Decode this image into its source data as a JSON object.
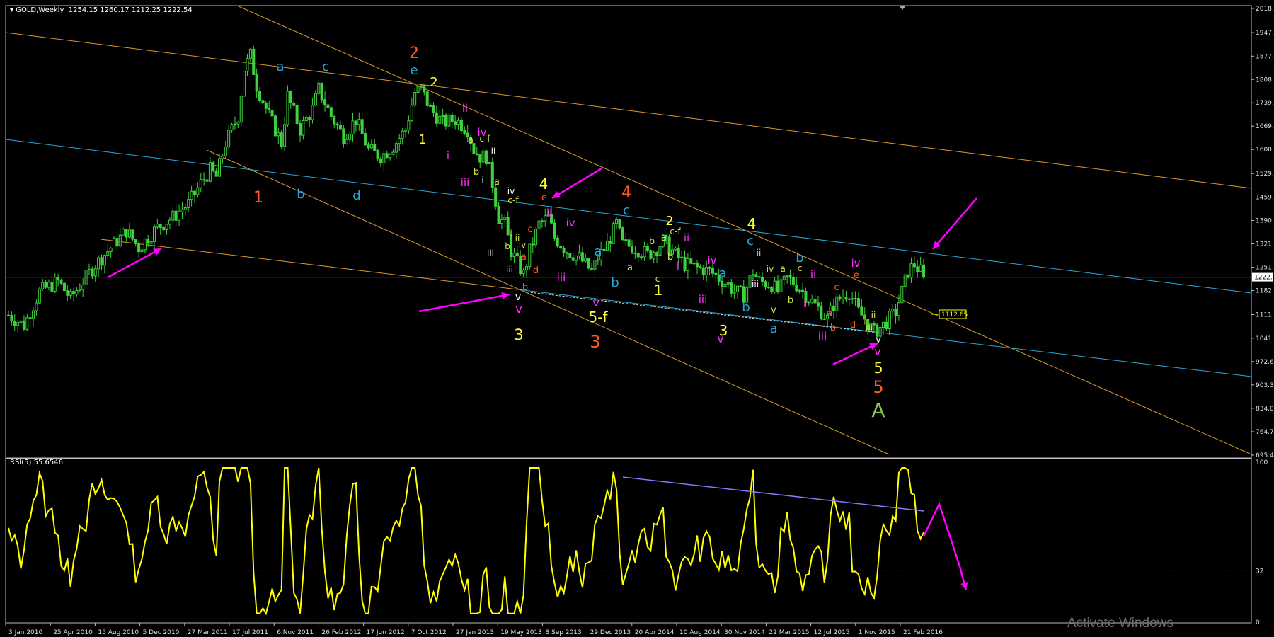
{
  "header": {
    "symbol": "GOLD,Weekly",
    "ohlc": "1254.15 1260.17 1212.25 1222.54"
  },
  "rsi_header": "RSI(5) 55.6546",
  "watermark": "Activate Windows",
  "price_marker": "1112.65",
  "current_price_label": "1222.5",
  "colors": {
    "candle": "#3cd33c",
    "orange_line": "#d99a2a",
    "blue_line": "#2aa7d6",
    "white_line": "#cfe6ef",
    "rsi": "#ffff00",
    "rsi_level": "#b0196e",
    "arrow": "#ff00ff",
    "rsi_trend": "#8877ff"
  },
  "chart_data": [
    {
      "type": "candlestick",
      "title": "GOLD,Weekly",
      "ylim": [
        695.4,
        2018.4
      ],
      "y_ticks": [
        "2018.4",
        "1947.0",
        "1877.3",
        "1808.2",
        "1739.1",
        "1669.9",
        "1600.8",
        "1529.5",
        "1459.5",
        "1390.5",
        "1321.3",
        "1251.9",
        "1182.8",
        "1111.6",
        "1041.6",
        "972.6",
        "903.3",
        "834.0",
        "764.7",
        "695.4"
      ],
      "x_ticks": [
        "3 Jan 2010",
        "25 Apr 2010",
        "15 Aug 2010",
        "5 Dec 2010",
        "27 Mar 2011",
        "17 Jul 2011",
        "6 Nov 2011",
        "26 Feb 2012",
        "17 Jun 2012",
        "7 Oct 2012",
        "27 Jan 2013",
        "19 May 2013",
        "8 Sep 2013",
        "29 Dec 2013",
        "20 Apr 2014",
        "10 Aug 2014",
        "30 Nov 2014",
        "22 Mar 2015",
        "12 Jul 2015",
        "1 Nov 2015",
        "21 Feb 2016"
      ],
      "close_path": [
        [
          0,
          1110
        ],
        [
          5,
          1080
        ],
        [
          10,
          1180
        ],
        [
          16,
          1210
        ],
        [
          20,
          1160
        ],
        [
          28,
          1260
        ],
        [
          33,
          1310
        ],
        [
          38,
          1360
        ],
        [
          42,
          1310
        ],
        [
          48,
          1370
        ],
        [
          53,
          1400
        ],
        [
          58,
          1440
        ],
        [
          62,
          1500
        ],
        [
          65,
          1540
        ],
        [
          67,
          1520
        ],
        [
          70,
          1620
        ],
        [
          74,
          1700
        ],
        [
          76,
          1840
        ],
        [
          78,
          1880
        ],
        [
          80,
          1790
        ],
        [
          84,
          1700
        ],
        [
          88,
          1620
        ],
        [
          90,
          1760
        ],
        [
          94,
          1660
        ],
        [
          98,
          1720
        ],
        [
          100,
          1780
        ],
        [
          104,
          1700
        ],
        [
          108,
          1640
        ],
        [
          112,
          1690
        ],
        [
          116,
          1600
        ],
        [
          120,
          1580
        ],
        [
          124,
          1610
        ],
        [
          128,
          1660
        ],
        [
          131,
          1770
        ],
        [
          133,
          1780
        ],
        [
          136,
          1720
        ],
        [
          140,
          1680
        ],
        [
          144,
          1690
        ],
        [
          148,
          1660
        ],
        [
          150,
          1600
        ],
        [
          152,
          1580
        ],
        [
          154,
          1580
        ],
        [
          156,
          1500
        ],
        [
          158,
          1400
        ],
        [
          160,
          1380
        ],
        [
          162,
          1300
        ],
        [
          166,
          1230
        ],
        [
          168,
          1300
        ],
        [
          171,
          1380
        ],
        [
          174,
          1400
        ],
        [
          176,
          1340
        ],
        [
          180,
          1300
        ],
        [
          184,
          1280
        ],
        [
          186,
          1260
        ],
        [
          188,
          1240
        ],
        [
          190,
          1280
        ],
        [
          193,
          1320
        ],
        [
          196,
          1380
        ],
        [
          198,
          1320
        ],
        [
          202,
          1310
        ],
        [
          206,
          1290
        ],
        [
          208,
          1300
        ],
        [
          211,
          1330
        ],
        [
          214,
          1300
        ],
        [
          218,
          1260
        ],
        [
          222,
          1250
        ],
        [
          226,
          1240
        ],
        [
          229,
          1220
        ],
        [
          232,
          1200
        ],
        [
          234,
          1180
        ],
        [
          237,
          1170
        ],
        [
          240,
          1240
        ],
        [
          242,
          1210
        ],
        [
          246,
          1200
        ],
        [
          248,
          1180
        ],
        [
          251,
          1220
        ],
        [
          254,
          1200
        ],
        [
          258,
          1160
        ],
        [
          261,
          1130
        ],
        [
          264,
          1100
        ],
        [
          266,
          1140
        ],
        [
          268,
          1160
        ],
        [
          271,
          1180
        ],
        [
          274,
          1120
        ],
        [
          276,
          1100
        ],
        [
          279,
          1060
        ],
        [
          282,
          1080
        ],
        [
          284,
          1100
        ],
        [
          286,
          1120
        ],
        [
          288,
          1180
        ],
        [
          290,
          1240
        ],
        [
          292,
          1260
        ],
        [
          294,
          1240
        ],
        [
          295,
          1222.54
        ]
      ]
    },
    {
      "type": "line",
      "title": "RSI(5) 55.6546",
      "ylim": [
        0,
        100
      ],
      "y_ticks": [
        "100",
        "32",
        "0"
      ],
      "levels": [
        32
      ]
    }
  ],
  "annotations": [
    {
      "t": "1",
      "c": "#ff5a1f",
      "x": 365,
      "y": 286,
      "s": 22
    },
    {
      "t": "2",
      "c": "#ff5a1f",
      "x": 585,
      "y": 82,
      "s": 22
    },
    {
      "t": "e",
      "c": "#2aa7d6",
      "x": 585,
      "y": 105,
      "s": 18
    },
    {
      "t": "2",
      "c": "#ffff33",
      "x": 613,
      "y": 122,
      "s": 18
    },
    {
      "t": "a",
      "c": "#2aa7d6",
      "x": 396,
      "y": 100,
      "s": 18
    },
    {
      "t": "c",
      "c": "#2aa7d6",
      "x": 460,
      "y": 100,
      "s": 18
    },
    {
      "t": "b",
      "c": "#2aa7d6",
      "x": 425,
      "y": 280,
      "s": 18
    },
    {
      "t": "d",
      "c": "#2aa7d6",
      "x": 504,
      "y": 282,
      "s": 18
    },
    {
      "t": "1",
      "c": "#ffff33",
      "x": 597,
      "y": 203,
      "s": 18
    },
    {
      "t": "ii",
      "c": "#ff33ff",
      "x": 657,
      "y": 158,
      "s": 15
    },
    {
      "t": "iv",
      "c": "#ff33ff",
      "x": 681,
      "y": 192,
      "s": 15
    },
    {
      "t": "c-f",
      "c": "#d2e84a",
      "x": 685,
      "y": 200,
      "s": 12
    },
    {
      "t": "ii",
      "c": "#ffffff",
      "x": 697,
      "y": 218,
      "s": 12
    },
    {
      "t": "a",
      "c": "#d2e84a",
      "x": 665,
      "y": 202,
      "s": 13
    },
    {
      "t": "i",
      "c": "#ff33ff",
      "x": 633,
      "y": 225,
      "s": 15
    },
    {
      "t": "b",
      "c": "#d2e84a",
      "x": 673,
      "y": 247,
      "s": 13
    },
    {
      "t": "i",
      "c": "#ffffff",
      "x": 682,
      "y": 258,
      "s": 12
    },
    {
      "t": "iii",
      "c": "#ff33ff",
      "x": 657,
      "y": 263,
      "s": 15
    },
    {
      "t": "a",
      "c": "#d2e84a",
      "x": 702,
      "y": 261,
      "s": 13
    },
    {
      "t": "iv",
      "c": "#ffffff",
      "x": 722,
      "y": 274,
      "s": 12
    },
    {
      "t": "c-f",
      "c": "#d2e84a",
      "x": 725,
      "y": 287,
      "s": 12
    },
    {
      "t": "iii",
      "c": "#ffffff",
      "x": 693,
      "y": 362,
      "s": 12
    },
    {
      "t": "ii",
      "c": "#d2e84a",
      "x": 731,
      "y": 340,
      "s": 12
    },
    {
      "t": "i",
      "c": "#d2e84a",
      "x": 722,
      "y": 334,
      "s": 12
    },
    {
      "t": "b",
      "c": "#d2e84a",
      "x": 717,
      "y": 352,
      "s": 12
    },
    {
      "t": "iv",
      "c": "#d2e84a",
      "x": 738,
      "y": 350,
      "s": 12
    },
    {
      "t": "a",
      "c": "#ff5a1f",
      "x": 740,
      "y": 367,
      "s": 13
    },
    {
      "t": "iii",
      "c": "#d2e84a",
      "x": 720,
      "y": 385,
      "s": 12
    },
    {
      "t": "b",
      "c": "#ff5a1f",
      "x": 742,
      "y": 410,
      "s": 13
    },
    {
      "t": "c",
      "c": "#ff5a1f",
      "x": 749,
      "y": 328,
      "s": 13
    },
    {
      "t": "d",
      "c": "#ff5a1f",
      "x": 757,
      "y": 386,
      "s": 13
    },
    {
      "t": "4",
      "c": "#ffff33",
      "x": 768,
      "y": 267,
      "s": 20
    },
    {
      "t": "e",
      "c": "#ff5a1f",
      "x": 769,
      "y": 283,
      "s": 13
    },
    {
      "t": "ii",
      "c": "#ff33ff",
      "x": 776,
      "y": 306,
      "s": 15
    },
    {
      "t": "iv",
      "c": "#ff33ff",
      "x": 806,
      "y": 320,
      "s": 15
    },
    {
      "t": "iii",
      "c": "#ff33ff",
      "x": 793,
      "y": 397,
      "s": 15
    },
    {
      "t": "v",
      "c": "#ffffff",
      "x": 732,
      "y": 424,
      "s": 14
    },
    {
      "t": "v",
      "c": "#ff33ff",
      "x": 733,
      "y": 442,
      "s": 16
    },
    {
      "t": "3",
      "c": "#ffff33",
      "x": 733,
      "y": 480,
      "s": 21
    },
    {
      "t": "3",
      "c": "#ff5a1f",
      "x": 841,
      "y": 491,
      "s": 24
    },
    {
      "t": "5-f",
      "c": "#ffff33",
      "x": 845,
      "y": 455,
      "s": 20
    },
    {
      "t": "v",
      "c": "#ff33ff",
      "x": 842,
      "y": 433,
      "s": 16
    },
    {
      "t": "a",
      "c": "#2aa7d6",
      "x": 845,
      "y": 361,
      "s": 18
    },
    {
      "t": "b",
      "c": "#2aa7d6",
      "x": 869,
      "y": 405,
      "s": 18
    },
    {
      "t": "a",
      "c": "#d2e84a",
      "x": 890,
      "y": 382,
      "s": 13
    },
    {
      "t": "4",
      "c": "#ff5a1f",
      "x": 885,
      "y": 279,
      "s": 22
    },
    {
      "t": "c",
      "c": "#2aa7d6",
      "x": 885,
      "y": 303,
      "s": 18
    },
    {
      "t": "b",
      "c": "#d2e84a",
      "x": 921,
      "y": 345,
      "s": 13
    },
    {
      "t": "a",
      "c": "#d2e84a",
      "x": 938,
      "y": 340,
      "s": 13
    },
    {
      "t": "2",
      "c": "#ffff33",
      "x": 946,
      "y": 318,
      "s": 18
    },
    {
      "t": "c-f",
      "c": "#d2e84a",
      "x": 954,
      "y": 331,
      "s": 12
    },
    {
      "t": "ii",
      "c": "#ff33ff",
      "x": 970,
      "y": 341,
      "s": 15
    },
    {
      "t": "b",
      "c": "#d2e84a",
      "x": 947,
      "y": 367,
      "s": 13
    },
    {
      "t": "i",
      "c": "#ff33ff",
      "x": 958,
      "y": 381,
      "s": 15
    },
    {
      "t": "c",
      "c": "#d2e84a",
      "x": 929,
      "y": 398,
      "s": 12
    },
    {
      "t": "1",
      "c": "#ffff33",
      "x": 930,
      "y": 417,
      "s": 20
    },
    {
      "t": "iv",
      "c": "#ff33ff",
      "x": 1006,
      "y": 373,
      "s": 15
    },
    {
      "t": "a",
      "c": "#2aa7d6",
      "x": 1021,
      "y": 392,
      "s": 18
    },
    {
      "t": "iii",
      "c": "#ff33ff",
      "x": 993,
      "y": 428,
      "s": 15
    },
    {
      "t": "v",
      "c": "#ff33ff",
      "x": 1018,
      "y": 484,
      "s": 16
    },
    {
      "t": "3",
      "c": "#ffff33",
      "x": 1022,
      "y": 474,
      "s": 20
    },
    {
      "t": "b",
      "c": "#2aa7d6",
      "x": 1054,
      "y": 440,
      "s": 18
    },
    {
      "t": "4",
      "c": "#ffff33",
      "x": 1062,
      "y": 323,
      "s": 20
    },
    {
      "t": "c",
      "c": "#2aa7d6",
      "x": 1060,
      "y": 346,
      "s": 18
    },
    {
      "t": "ii",
      "c": "#d2e84a",
      "x": 1072,
      "y": 361,
      "s": 12
    },
    {
      "t": "iii",
      "c": "#ffffff",
      "x": 1067,
      "y": 405,
      "s": 12
    },
    {
      "t": "iv",
      "c": "#d2e84a",
      "x": 1088,
      "y": 384,
      "s": 12
    },
    {
      "t": "a",
      "c": "#d2e84a",
      "x": 1106,
      "y": 384,
      "s": 13
    },
    {
      "t": "v",
      "c": "#d2e84a",
      "x": 1093,
      "y": 442,
      "s": 13
    },
    {
      "t": "b",
      "c": "#d2e84a",
      "x": 1117,
      "y": 428,
      "s": 13
    },
    {
      "t": "a",
      "c": "#2aa7d6",
      "x": 1093,
      "y": 470,
      "s": 18
    },
    {
      "t": "b",
      "c": "#2aa7d6",
      "x": 1130,
      "y": 370,
      "s": 18
    },
    {
      "t": "c",
      "c": "#d2e84a",
      "x": 1130,
      "y": 383,
      "s": 12
    },
    {
      "t": "i",
      "c": "#ff33ff",
      "x": 1137,
      "y": 434,
      "s": 15
    },
    {
      "t": "ii",
      "c": "#ff33ff",
      "x": 1149,
      "y": 393,
      "s": 15
    },
    {
      "t": "c",
      "c": "#ff5a1f",
      "x": 1182,
      "y": 410,
      "s": 13
    },
    {
      "t": "iii",
      "c": "#ff33ff",
      "x": 1162,
      "y": 480,
      "s": 15
    },
    {
      "t": "a",
      "c": "#ff5a1f",
      "x": 1172,
      "y": 447,
      "s": 13
    },
    {
      "t": "b",
      "c": "#ff5a1f",
      "x": 1177,
      "y": 467,
      "s": 13
    },
    {
      "t": "d",
      "c": "#ff5a1f",
      "x": 1205,
      "y": 463,
      "s": 13
    },
    {
      "t": "iv",
      "c": "#ff33ff",
      "x": 1209,
      "y": 377,
      "s": 15
    },
    {
      "t": "e",
      "c": "#ff5a1f",
      "x": 1210,
      "y": 393,
      "s": 13
    },
    {
      "t": "ii",
      "c": "#d2e84a",
      "x": 1234,
      "y": 449,
      "s": 12
    },
    {
      "t": "i",
      "c": "#ff5a1f",
      "x": 1222,
      "y": 458,
      "s": 12
    },
    {
      "t": "iii",
      "c": "#d2e84a",
      "x": 1228,
      "y": 468,
      "s": 12
    },
    {
      "t": "v",
      "c": "#ffffff",
      "x": 1241,
      "y": 484,
      "s": 13
    },
    {
      "t": "v",
      "c": "#ff33ff",
      "x": 1240,
      "y": 502,
      "s": 16
    },
    {
      "t": "5",
      "c": "#ffff33",
      "x": 1241,
      "y": 527,
      "s": 21
    },
    {
      "t": "5",
      "c": "#ff5a1f",
      "x": 1241,
      "y": 555,
      "s": 24
    },
    {
      "t": "A",
      "c": "#8bc34a",
      "x": 1241,
      "y": 589,
      "s": 28
    }
  ],
  "arrows": [
    [
      152,
      392,
      228,
      351
    ],
    [
      592,
      440,
      720,
      416
    ],
    [
      850,
      238,
      780,
      280
    ],
    [
      1380,
      280,
      1318,
      352
    ],
    [
      1177,
      515,
      1240,
      485
    ],
    [
      1356,
      800,
      1365,
      834
    ]
  ]
}
